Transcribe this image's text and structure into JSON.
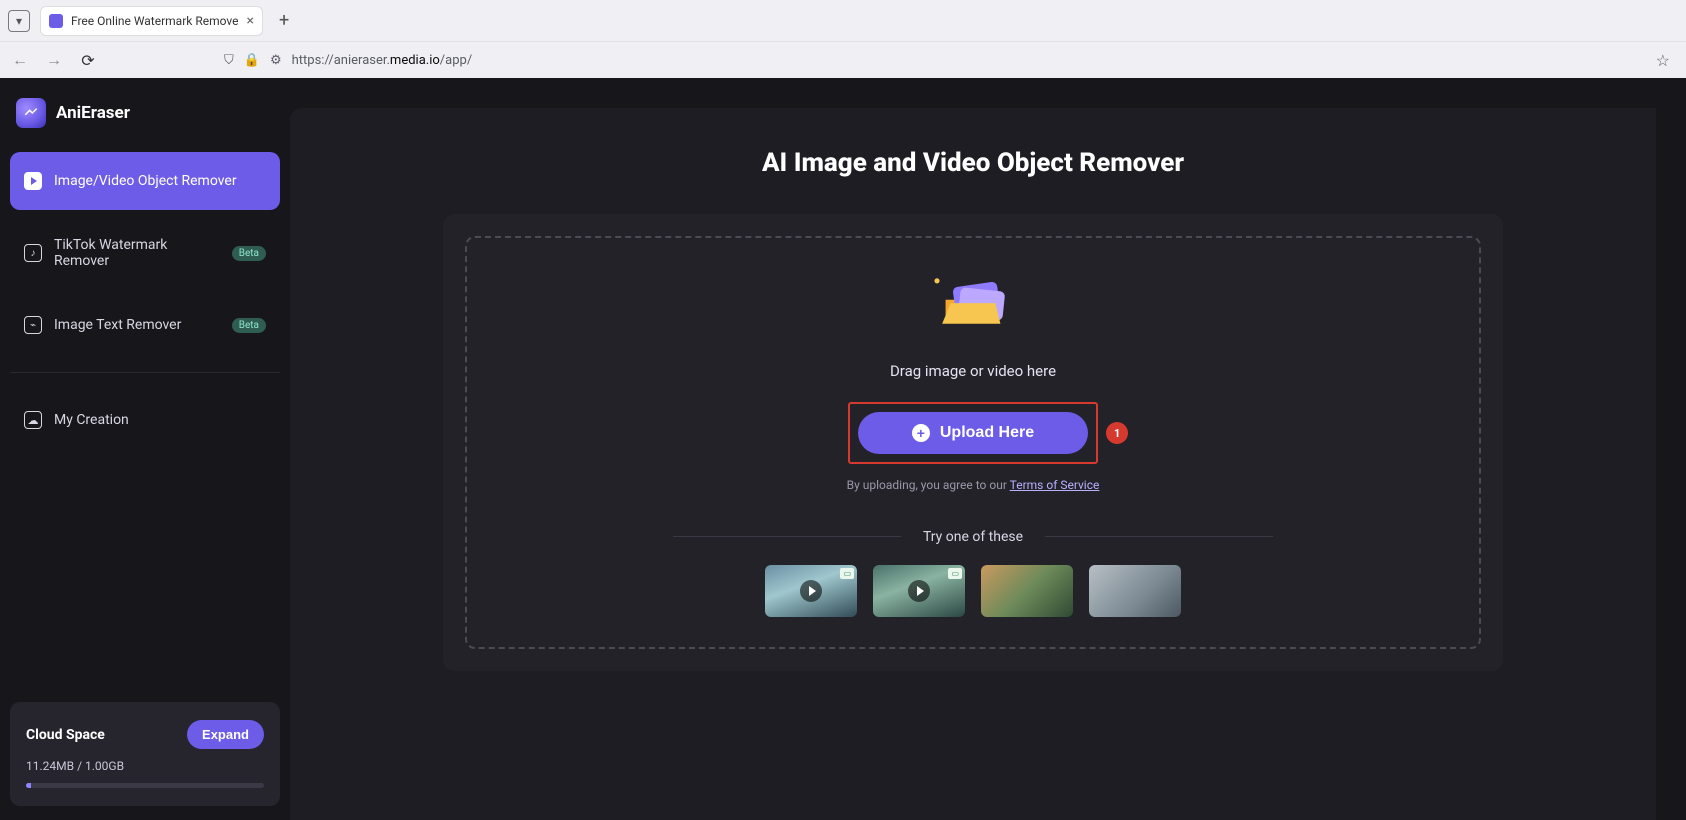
{
  "browser": {
    "tab_title": "Free Online Watermark Remove",
    "url_pre": "https://anieraser.",
    "url_domain": "media.io",
    "url_post": "/app/"
  },
  "app": {
    "name": "AniEraser",
    "sidebar": {
      "items": [
        {
          "label": "Image/Video Object Remover",
          "active": true
        },
        {
          "label": "TikTok Watermark Remover",
          "badge": "Beta"
        },
        {
          "label": "Image Text Remover",
          "badge": "Beta"
        }
      ],
      "my_creation": "My Creation",
      "cloud": {
        "title": "Cloud Space",
        "usage": "11.24MB / 1.00GB",
        "expand": "Expand"
      }
    },
    "main": {
      "title": "AI Image and Video Object Remover",
      "drag_text": "Drag image or video here",
      "upload_label": "Upload Here",
      "annotation_number": "1",
      "tos_pre": "By uploading, you agree to our ",
      "tos_link": "Terms of Service",
      "try_label": "Try one of these"
    }
  }
}
